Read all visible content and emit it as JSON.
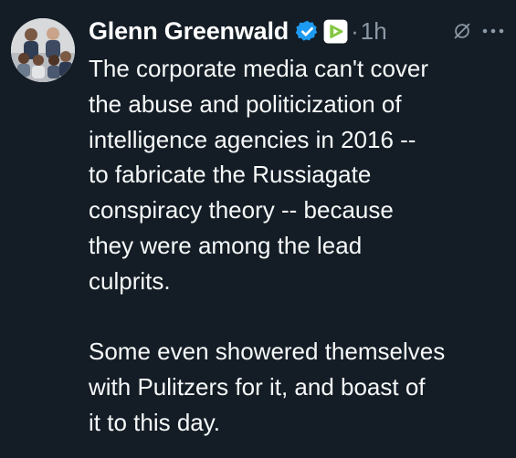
{
  "tweet": {
    "author_name": "Glenn Greenwald",
    "time": "1h",
    "separator": "·",
    "body": {
      "paragraph_1_lines": [
        "The corporate media can't cover",
        "the abuse and politicization of",
        "intelligence agencies in 2016 --",
        "to fabricate the Russiagate",
        "conspiracy theory -- because",
        "they were among the lead",
        "culprits."
      ],
      "paragraph_2_lines": [
        "Some even showered themselves",
        "with Pulitzers for it, and boast of",
        "it to this day."
      ]
    },
    "icons": {
      "verified": "verified-badge-icon",
      "affiliate": "rumble-play-icon",
      "grok": "grok-icon",
      "more": "more-options-icon"
    },
    "colors": {
      "background": "#141d26",
      "verified": "#1d9bf0",
      "affiliate": "#85c742",
      "muted": "#8b98a5"
    }
  }
}
